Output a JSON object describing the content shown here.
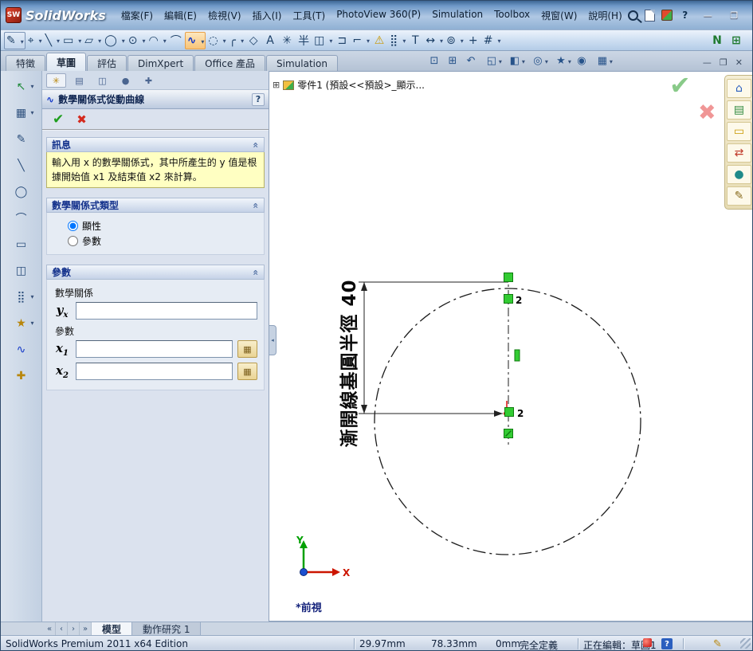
{
  "window": {
    "app_title": "SolidWorks",
    "menus": [
      "檔案(F)",
      "編輯(E)",
      "檢視(V)",
      "插入(I)",
      "工具(T)",
      "PhotoView 360(P)",
      "Simulation",
      "Toolbox",
      "視窗(W)",
      "說明(H)"
    ],
    "help_glyph": "?",
    "minimize_glyph": "—",
    "maximize_glyph": "❐",
    "close_glyph": "✕"
  },
  "toolbar": {
    "icons": [
      {
        "name": "sketch",
        "glyph": "✎"
      },
      {
        "name": "smart-dimension",
        "glyph": "⌖"
      },
      {
        "name": "line",
        "glyph": "╲"
      },
      {
        "name": "corner-rectangle",
        "glyph": "▭"
      },
      {
        "name": "straight-slot",
        "glyph": "▱"
      },
      {
        "name": "circle",
        "glyph": "◯"
      },
      {
        "name": "perimeter-circle",
        "glyph": "⊙"
      },
      {
        "name": "centerpoint-arc",
        "glyph": "◠"
      },
      {
        "name": "tangent-arc",
        "glyph": "⌒"
      },
      {
        "name": "spline",
        "glyph": "∿"
      },
      {
        "name": "ellipse",
        "glyph": "◌"
      },
      {
        "name": "sketch-fillet",
        "glyph": "╭"
      },
      {
        "name": "polygon",
        "glyph": "◇"
      },
      {
        "name": "text",
        "glyph": "A"
      },
      {
        "name": "point",
        "glyph": "✳"
      },
      {
        "name": "centerline",
        "glyph": "半"
      },
      {
        "name": "mirror-entities",
        "glyph": "◫"
      },
      {
        "name": "convert-entities",
        "glyph": "⊐"
      },
      {
        "name": "offset-entities",
        "glyph": "⌐"
      },
      {
        "name": "sketch-alert",
        "glyph": "⚠"
      },
      {
        "name": "linear-pattern",
        "glyph": "⣿"
      },
      {
        "name": "trim-entities",
        "glyph": "T"
      },
      {
        "name": "move-entities",
        "glyph": "↔"
      },
      {
        "name": "display-relations",
        "glyph": "⊚"
      },
      {
        "name": "repair-sketch",
        "glyph": "+"
      },
      {
        "name": "quick-snaps",
        "glyph": "#"
      }
    ],
    "right_icons": [
      {
        "name": "instant2d",
        "glyph": "N"
      },
      {
        "name": "grid-settings",
        "glyph": "⊞"
      }
    ]
  },
  "ribbon": {
    "tabs": [
      "特徵",
      "草圖",
      "評估",
      "DimXpert",
      "Office 產品",
      "Simulation"
    ],
    "doc_minimize": "—",
    "doc_restore": "❐",
    "doc_close": "✕"
  },
  "headsup": {
    "icons": [
      {
        "name": "zoom-fit",
        "glyph": "⊡"
      },
      {
        "name": "zoom-area",
        "glyph": "⊞"
      },
      {
        "name": "previous-view",
        "glyph": "↶"
      },
      {
        "name": "section-view",
        "glyph": "◱"
      },
      {
        "name": "view-orientation",
        "glyph": "◧"
      },
      {
        "name": "display-style",
        "glyph": "◎"
      },
      {
        "name": "hide-show-items",
        "glyph": "★"
      },
      {
        "name": "edit-appearance",
        "glyph": "◉"
      },
      {
        "name": "apply-scene",
        "glyph": "▦"
      }
    ]
  },
  "left_toolbar": {
    "icons": [
      {
        "name": "select",
        "glyph": "↖"
      },
      {
        "name": "view-orientation",
        "glyph": "▦"
      },
      {
        "name": "sketch-entity",
        "glyph": "✎"
      },
      {
        "name": "line",
        "glyph": "╲"
      },
      {
        "name": "circle",
        "glyph": "◯"
      },
      {
        "name": "arc",
        "glyph": "⌒"
      },
      {
        "name": "rectangle",
        "glyph": "▭"
      },
      {
        "name": "mirror",
        "glyph": "◫"
      },
      {
        "name": "pattern",
        "glyph": "⣿"
      },
      {
        "name": "relations",
        "glyph": "★"
      },
      {
        "name": "spline",
        "glyph": "∿"
      },
      {
        "name": "options",
        "glyph": "✚"
      }
    ]
  },
  "property_manager": {
    "tab_icons": [
      {
        "name": "properties",
        "glyph": "✳"
      },
      {
        "name": "configurations",
        "glyph": "▤"
      },
      {
        "name": "dimxpert",
        "glyph": "◫"
      },
      {
        "name": "display",
        "glyph": "●"
      },
      {
        "name": "more",
        "glyph": "✚"
      }
    ],
    "title": "數學關係式從動曲線",
    "title_icon_glyph": "∿",
    "help_glyph": "?",
    "ok_glyph": "✔",
    "cancel_glyph": "✖",
    "collapse_glyph": "«",
    "message": {
      "header": "訊息",
      "body": "輸入用 x 的數學關係式，其中所產生的 y 值是根據開始值 x1 及結束值 x2 來計算。"
    },
    "equation_type": {
      "header": "數學關係式類型",
      "explicit_label": "顯性",
      "parametric_label": "參數"
    },
    "parameters": {
      "header": "參數",
      "equation_label": "數學關係",
      "y_symbol": "y",
      "y_sub": "x",
      "y_value": "",
      "params_label": "參數",
      "x1_symbol": "x",
      "x1_sub": "1",
      "x1_value": "",
      "x2_symbol": "x",
      "x2_sub": "2",
      "x2_value": "",
      "link_glyph": "▦"
    }
  },
  "viewport": {
    "tree_expand_glyph": "⊞",
    "feature_tree_label": "零件1 (預設<<預設>_顯示...",
    "confirm_glyph": "✔",
    "cancel_glyph": "✖",
    "dimension_label": "漸開線基圓半徑 40",
    "constraint_badge": "2",
    "axis_x": "X",
    "axis_y": "Y",
    "view_label": "*前視",
    "splitter_glyph": "◂"
  },
  "task_pane": {
    "icons": [
      {
        "name": "resources",
        "glyph": "⌂"
      },
      {
        "name": "design-library",
        "glyph": "▤"
      },
      {
        "name": "file-explorer",
        "glyph": "▭"
      },
      {
        "name": "toolbox",
        "glyph": "⇄"
      },
      {
        "name": "appearances",
        "glyph": "●"
      },
      {
        "name": "custom-properties",
        "glyph": "✎"
      }
    ]
  },
  "bottom_tabs": {
    "nav": [
      {
        "name": "scroll-first",
        "glyph": "«"
      },
      {
        "name": "scroll-prev",
        "glyph": "‹"
      },
      {
        "name": "scroll-next",
        "glyph": "›"
      },
      {
        "name": "scroll-last",
        "glyph": "»"
      }
    ],
    "tabs": [
      "模型",
      "動作研究 1"
    ]
  },
  "status_bar": {
    "product": "SolidWorks Premium 2011 x64 Edition",
    "x": "29.97mm",
    "y": "78.33mm",
    "z": "0mm",
    "definition": "完全定義",
    "editing": "正在編輯：草圖1",
    "help_glyph": "?",
    "pencil_glyph": "✎"
  }
}
